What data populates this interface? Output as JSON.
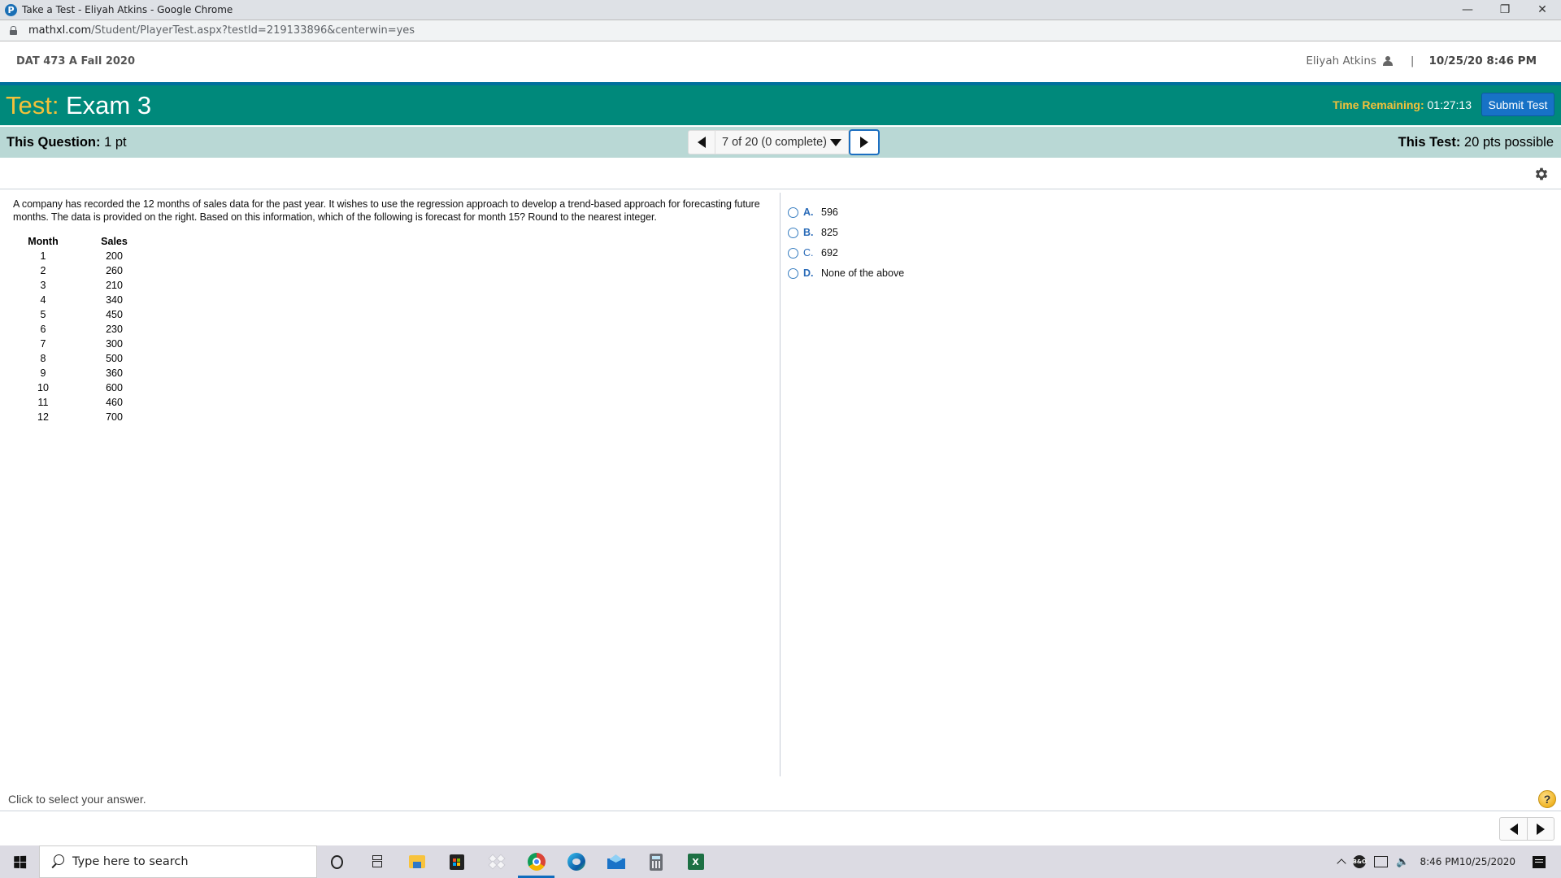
{
  "browser": {
    "window_title": "Take a Test - Eliyah Atkins - Google Chrome",
    "favicon_letter": "P",
    "url_host": "mathxl.com",
    "url_path": "/Student/PlayerTest.aspx?testId=219133896&centerwin=yes",
    "window_controls": {
      "minimize": "—",
      "restore": "❐",
      "close": "✕"
    }
  },
  "course_header": {
    "course_name": "DAT 473 A Fall 2020",
    "user_name": "Eliyah Atkins",
    "separator": "|",
    "datetime": "10/25/20 8:46 PM"
  },
  "test_banner": {
    "label": "Test:",
    "name": "Exam 3",
    "time_remaining_label": "Time Remaining:",
    "time_remaining_value": "01:27:13",
    "submit_label": "Submit Test",
    "colors": {
      "banner": "#00897b",
      "accent": "#f3c13a",
      "submit": "#1772c6"
    }
  },
  "question_bar": {
    "this_question_label": "This Question:",
    "this_question_value": "1 pt",
    "navigator_text": "7 of 20 (0 complete)",
    "this_test_label": "This Test:",
    "this_test_value": "20 pts possible"
  },
  "question": {
    "text": "A company has recorded the 12 months of sales data for the past year. It wishes to use the regression approach to develop a trend-based approach for forecasting future months. The data is provided on the right. Based on this information, which of the following is forecast for month 15? Round to the nearest integer.",
    "table": {
      "headers": [
        "Month",
        "Sales"
      ],
      "rows": [
        [
          "1",
          "200"
        ],
        [
          "2",
          "260"
        ],
        [
          "3",
          "210"
        ],
        [
          "4",
          "340"
        ],
        [
          "5",
          "450"
        ],
        [
          "6",
          "230"
        ],
        [
          "7",
          "300"
        ],
        [
          "8",
          "500"
        ],
        [
          "9",
          "360"
        ],
        [
          "10",
          "600"
        ],
        [
          "11",
          "460"
        ],
        [
          "12",
          "700"
        ]
      ]
    }
  },
  "answers": [
    {
      "letter": "A.",
      "value": "596"
    },
    {
      "letter": "B.",
      "value": "825"
    },
    {
      "letter": "C.",
      "value": "692"
    },
    {
      "letter": "D.",
      "value": "None of the above"
    }
  ],
  "footer": {
    "hint": "Click to select your answer.",
    "help_symbol": "?"
  },
  "taskbar": {
    "search_placeholder": "Type here to search",
    "excel_letter": "X",
    "tray_bo_label": "B&O",
    "volume_symbol": "🔈",
    "clock_time": "8:46 PM",
    "clock_date": "10/25/2020"
  }
}
